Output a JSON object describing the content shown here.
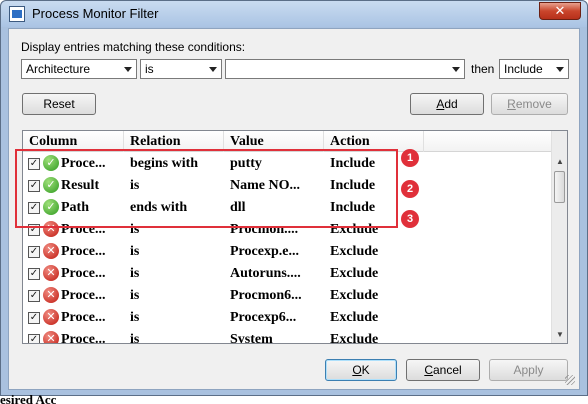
{
  "window": {
    "title": "Process Monitor Filter",
    "close_glyph": "✕"
  },
  "conditions": {
    "label": "Display entries matching these conditions:",
    "column_value": "Architecture",
    "relation_value": "is",
    "value_value": "",
    "then_label": "then",
    "action_value": "Include"
  },
  "buttons": {
    "reset": "Reset",
    "add": "Add",
    "remove": "Remove",
    "ok": "OK",
    "cancel": "Cancel",
    "apply": "Apply"
  },
  "table": {
    "headers": [
      "Column",
      "Relation",
      "Value",
      "Action"
    ],
    "rows": [
      {
        "checked": true,
        "status": "include",
        "column": "Proce...",
        "relation": "begins with",
        "value": "putty",
        "action": "Include"
      },
      {
        "checked": true,
        "status": "include",
        "column": "Result",
        "relation": "is",
        "value": "Name NO...",
        "action": "Include"
      },
      {
        "checked": true,
        "status": "include",
        "column": "Path",
        "relation": "ends with",
        "value": "dll",
        "action": "Include"
      },
      {
        "checked": true,
        "status": "exclude",
        "column": "Proce...",
        "relation": "is",
        "value": "Procmon....",
        "action": "Exclude"
      },
      {
        "checked": true,
        "status": "exclude",
        "column": "Proce...",
        "relation": "is",
        "value": "Procexp.e...",
        "action": "Exclude"
      },
      {
        "checked": true,
        "status": "exclude",
        "column": "Proce...",
        "relation": "is",
        "value": "Autoruns....",
        "action": "Exclude"
      },
      {
        "checked": true,
        "status": "exclude",
        "column": "Proce...",
        "relation": "is",
        "value": "Procmon6...",
        "action": "Exclude"
      },
      {
        "checked": true,
        "status": "exclude",
        "column": "Proce...",
        "relation": "is",
        "value": "Procexp6...",
        "action": "Exclude"
      },
      {
        "checked": true,
        "status": "exclude",
        "column": "Proce...",
        "relation": "is",
        "value": "System",
        "action": "Exclude"
      }
    ]
  },
  "annotations": {
    "badges": [
      "1",
      "2",
      "3"
    ],
    "color": "#e0303a"
  },
  "icons": {
    "include": "check-icon",
    "exclude": "x-icon",
    "check_glyph": "✓",
    "x_glyph": "✕"
  },
  "background_text": "esired Acc"
}
